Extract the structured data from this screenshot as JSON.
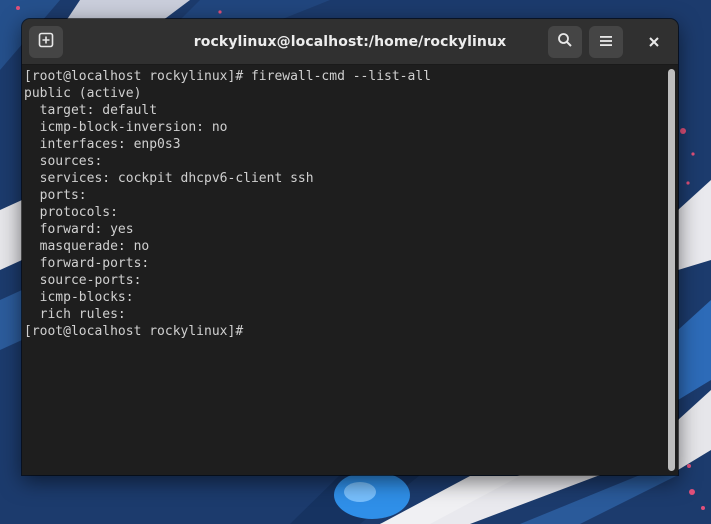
{
  "window": {
    "title": "rockylinux@localhost:/home/rockylinux"
  },
  "headerbar": {
    "new_tab_icon": "new-tab-icon",
    "search_icon": "search-icon",
    "menu_icon": "hamburger-menu-icon",
    "close_icon": "close-icon"
  },
  "terminal": {
    "lines": [
      "[root@localhost rockylinux]# firewall-cmd --list-all",
      "public (active)",
      "  target: default",
      "  icmp-block-inversion: no",
      "  interfaces: enp0s3",
      "  sources: ",
      "  services: cockpit dhcpv6-client ssh",
      "  ports: ",
      "  protocols: ",
      "  forward: yes",
      "  masquerade: no",
      "  forward-ports: ",
      "  source-ports: ",
      "  icmp-blocks: ",
      "  rich rules: ",
      "[root@localhost rockylinux]# "
    ]
  },
  "colors": {
    "desktop_background": "#1b3a6b",
    "titlebar": "#303030",
    "terminal_background": "#1e1e1e",
    "terminal_text": "#d0d0d0",
    "title_text": "#ededed"
  }
}
